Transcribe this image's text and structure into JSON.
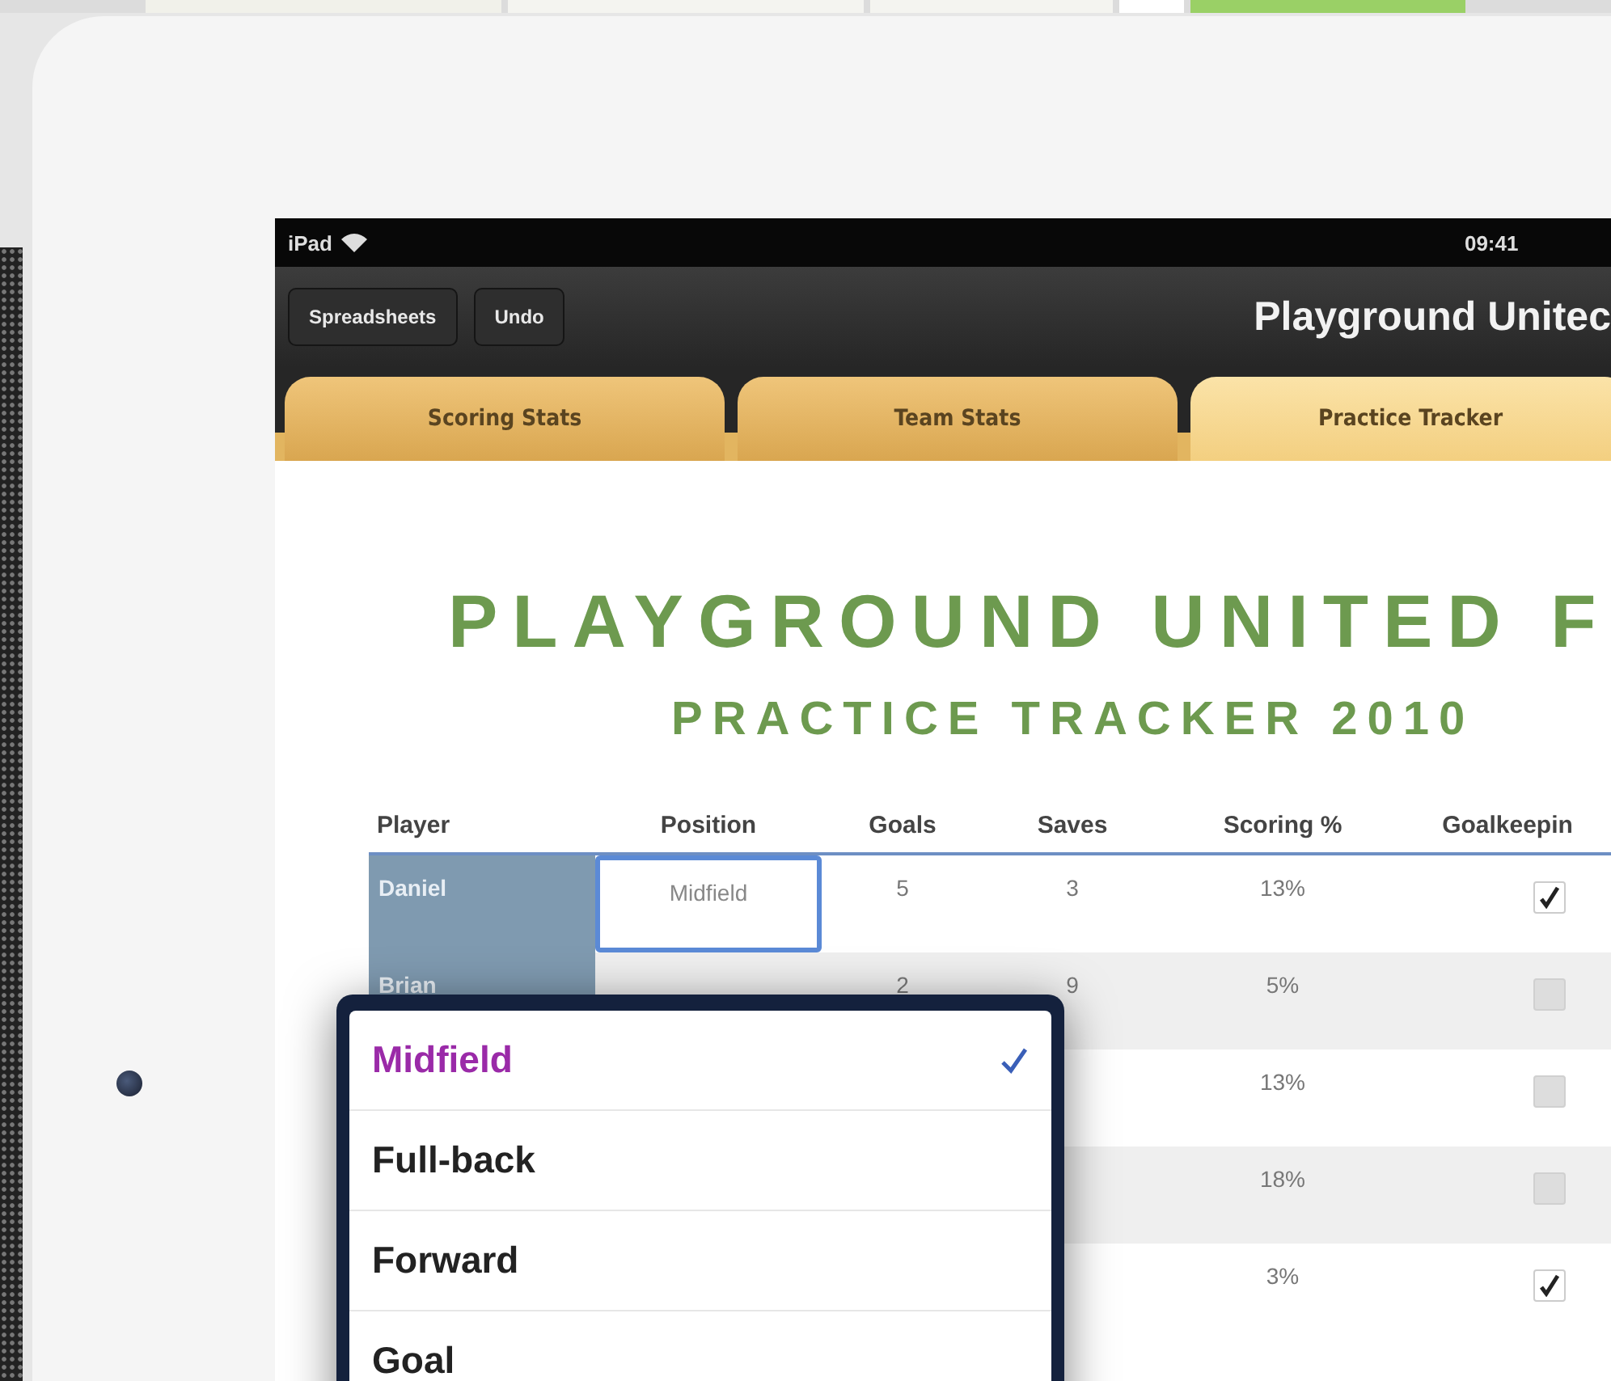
{
  "status_bar": {
    "device": "iPad",
    "time": "09:41"
  },
  "toolbar": {
    "buttons": [
      "Spreadsheets",
      "Undo"
    ],
    "title": "Playground Unitec"
  },
  "tabs": [
    {
      "label": "Scoring Stats",
      "selected": false
    },
    {
      "label": "Team Stats",
      "selected": false
    },
    {
      "label": "Practice Tracker",
      "selected": true
    }
  ],
  "sheet": {
    "title": "PLAYGROUND UNITED F",
    "subtitle": "PRACTICE TRACKER 2010"
  },
  "table": {
    "columns": [
      "Player",
      "Position",
      "Goals",
      "Saves",
      "Scoring %",
      "Goalkeepin"
    ],
    "rows": [
      {
        "player": "Daniel",
        "position": "Midfield",
        "goals": "5",
        "saves": "3",
        "scoring": "13%",
        "goalkeeping": true,
        "selected": true
      },
      {
        "player": "Brian",
        "goals": "2",
        "saves": "9",
        "scoring": "5%",
        "goalkeeping": false,
        "selected": false
      },
      {
        "scoring": "13%",
        "goalkeeping": false
      },
      {
        "scoring": "18%",
        "goalkeeping": false
      },
      {
        "scoring": "3%",
        "goalkeeping": true
      }
    ]
  },
  "popover": {
    "options": [
      {
        "label": "Midfield",
        "selected": true
      },
      {
        "label": "Full-back",
        "selected": false
      },
      {
        "label": "Forward",
        "selected": false
      },
      {
        "label": "Goal",
        "selected": false
      }
    ]
  }
}
